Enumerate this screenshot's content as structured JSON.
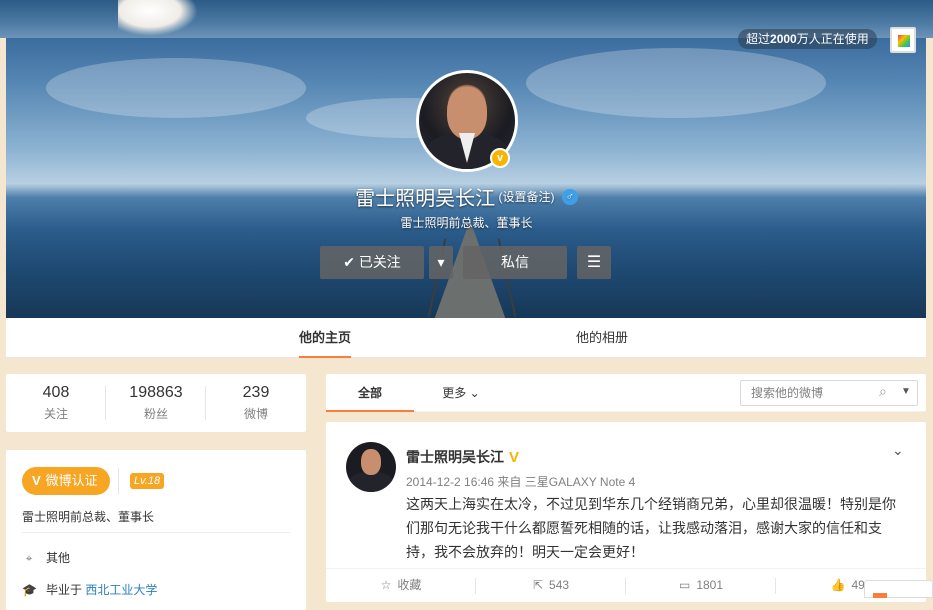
{
  "header": {
    "usage_text_prefix": "超过",
    "usage_count": "2000",
    "usage_text_suffix": "万人正在使用"
  },
  "profile": {
    "name": "雷士照明吴长江",
    "remark_label": "(设置备注)",
    "gender_icon": "male-icon",
    "gender_symbol": "♂",
    "verified_symbol": "v",
    "title": "雷士照明前总裁、董事长",
    "follow_button": "已关注",
    "follow_check": "✔",
    "dropdown_symbol": "▾",
    "message_button": "私信",
    "menu_symbol": "☰"
  },
  "nav": {
    "tabs": [
      {
        "label": "他的主页",
        "active": true
      },
      {
        "label": "他的相册",
        "active": false
      }
    ]
  },
  "stats": [
    {
      "value": "408",
      "label": "关注"
    },
    {
      "value": "198863",
      "label": "粉丝"
    },
    {
      "value": "239",
      "label": "微博"
    }
  ],
  "info": {
    "verify_badge_symbol": "V",
    "verify_badge": "微博认证",
    "level": "Lv.18",
    "description": "雷士照明前总裁、董事长",
    "location_icon": "⌖",
    "location": "其他",
    "education_icon": "🎓",
    "education_prefix": "毕业于",
    "school": "西北工业大学"
  },
  "feed_filter": {
    "tabs": [
      {
        "label": "全部",
        "active": true
      },
      {
        "label": "更多",
        "active": false
      }
    ],
    "more_chevron": "⌄",
    "search_placeholder": "搜索他的微博",
    "search_icon": "⌕",
    "search_dropdown": "▼"
  },
  "post": {
    "author": "雷士照明吴长江",
    "verified_symbol": "V",
    "time": "2014-12-2 16:46",
    "source_prefix": "来自",
    "source": "三星GALAXY Note 4",
    "text": "这两天上海实在太冷，不过见到华东几个经销商兄弟，心里却很温暖！特别是你们那句无论我干什么都愿誓死相随的话，让我感动落泪，感谢大家的信任和支持，我不会放弃的！明天一定会更好！",
    "chevron": "⌄",
    "actions": [
      {
        "icon": "star-icon",
        "glyph": "☆",
        "label": "收藏"
      },
      {
        "icon": "share-icon",
        "glyph": "⇱",
        "label": "543"
      },
      {
        "icon": "comment-icon",
        "glyph": "▭",
        "label": "1801"
      },
      {
        "icon": "like-icon",
        "glyph": "👍",
        "label": "497"
      }
    ]
  }
}
